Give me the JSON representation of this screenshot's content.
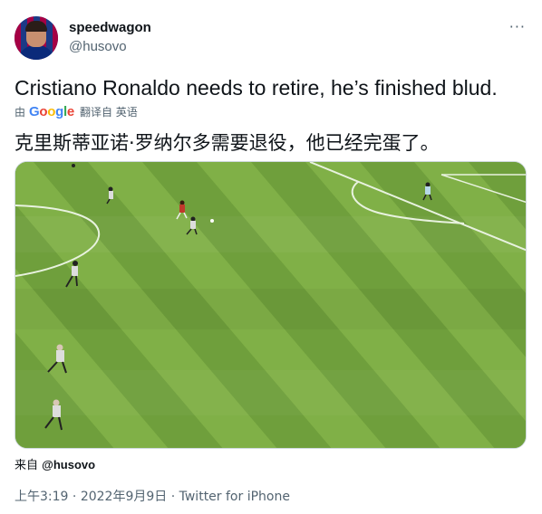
{
  "author": {
    "display_name": "speedwagon",
    "handle": "@husovo"
  },
  "more_menu": "···",
  "tweet": {
    "text": "Cristiano Ronaldo needs to retire, he’s finished blud.",
    "translation_by": "由",
    "translation_provider": "Google",
    "translation_label": "翻译自 英语",
    "translated_text": "克里斯蒂亚诺·罗纳尔多需要退役，他已经完蛋了。"
  },
  "media_source": {
    "prefix": "来自",
    "handle": "@husovo"
  },
  "meta": {
    "time": "上午3:19",
    "separator": " · ",
    "date": "2022年9月9日",
    "client": "Twitter for iPhone"
  },
  "colors": {
    "pitch_light": "#7fae45",
    "pitch_dark": "#689a35",
    "google_blue": "#4285F4",
    "google_red": "#EA4335",
    "google_yellow": "#FBBC05",
    "google_green": "#34A853"
  },
  "icons": [
    "more-options-icon"
  ]
}
